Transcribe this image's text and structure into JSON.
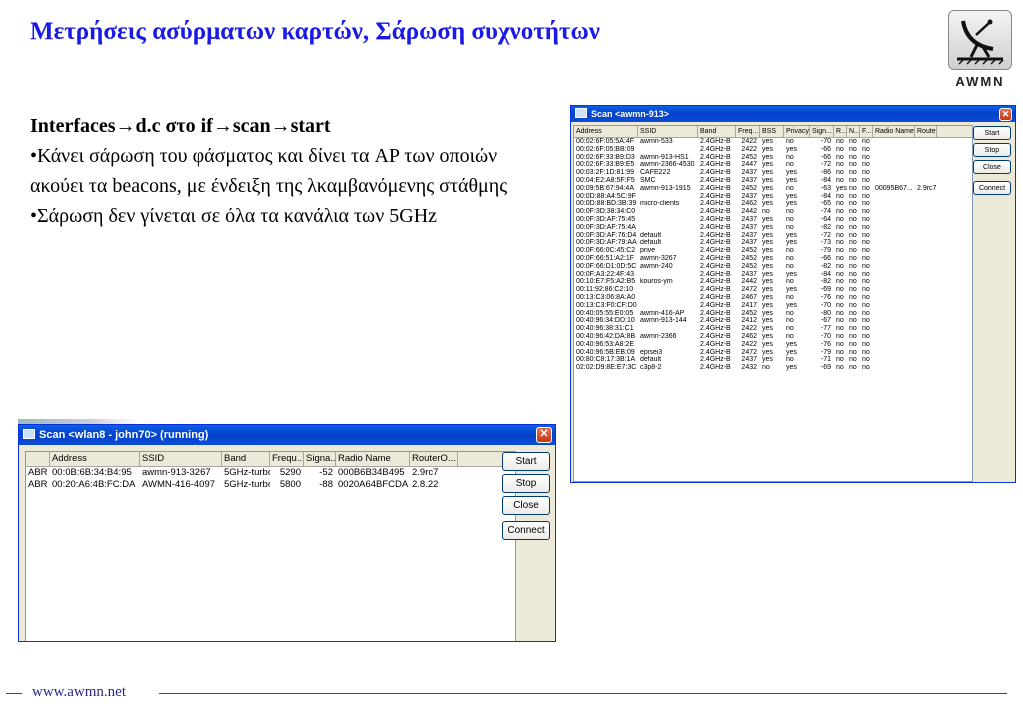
{
  "slide": {
    "title": "Μετρήσεις ασύρματων καρτών, Σάρωση συχνοτήτων",
    "logo_text": "AWMN",
    "heading": "Interfaces→d.c στο if→scan→start",
    "bullets": [
      "•Κάνει σάρωση του φάσματος και δίνει τα AP των οποιών ακούει τα beacons, με ένδειξη της λκαμβανόμενης στάθμης",
      "•Σάρωση δεν γίνεται σε όλα τα κανάλια των 5GHz"
    ],
    "footer_url": "www.awmn.net"
  },
  "scan_big": {
    "title": "Scan <awmn-913>",
    "close": "✕",
    "columns": [
      "Address",
      "SSID",
      "Band",
      "Freq...",
      "BSS",
      "Privacy",
      "Sign...",
      "R...",
      "N...",
      "F...",
      "Radio Name",
      "Router..."
    ],
    "rows": [
      [
        "00:02:6F:05:5A:4F",
        "awmn-533",
        "2.4GHz-B",
        "2422",
        "yes",
        "no",
        "-70",
        "no",
        "no",
        "no",
        "",
        ""
      ],
      [
        "00:02:6F:05:BB:09",
        "",
        "2.4GHz-B",
        "2422",
        "yes",
        "yes",
        "-66",
        "no",
        "no",
        "no",
        "",
        ""
      ],
      [
        "00:02:6F:33:B9:D3",
        "awmn-913-HS1",
        "2.4GHz-B",
        "2452",
        "yes",
        "no",
        "-66",
        "no",
        "no",
        "no",
        "",
        ""
      ],
      [
        "00:02:6F:33:B9:E5",
        "awmn-2366-4530",
        "2.4GHz-B",
        "2447",
        "yes",
        "no",
        "-72",
        "no",
        "no",
        "no",
        "",
        ""
      ],
      [
        "00:03:2F:1D:81:99",
        "CAFE222",
        "2.4GHz-B",
        "2437",
        "yes",
        "yes",
        "-86",
        "no",
        "no",
        "no",
        "",
        ""
      ],
      [
        "00:04:E2:A8:5F:F5",
        "SMC",
        "2.4GHz-B",
        "2437",
        "yes",
        "yes",
        "-84",
        "no",
        "no",
        "no",
        "",
        ""
      ],
      [
        "00:09:5B:67:94:4A",
        "awmn-913-1915",
        "2.4GHz-B",
        "2452",
        "yes",
        "no",
        "-63",
        "yes",
        "no",
        "no",
        "00095B67...",
        "2.9rc7"
      ],
      [
        "00:0D:88:A4:5C:9F",
        "",
        "2.4GHz-B",
        "2437",
        "yes",
        "yes",
        "-84",
        "no",
        "no",
        "no",
        "",
        ""
      ],
      [
        "00:0D:88:BD:3B:39",
        "micro-clients",
        "2.4GHz-B",
        "2462",
        "yes",
        "yes",
        "-65",
        "no",
        "no",
        "no",
        "",
        ""
      ],
      [
        "00:0F:3D:38:34:C0",
        "",
        "2.4GHz-B",
        "2442",
        "no",
        "no",
        "-74",
        "no",
        "no",
        "no",
        "",
        ""
      ],
      [
        "00:0F:3D:AF:75:45",
        "",
        "2.4GHz-B",
        "2437",
        "yes",
        "no",
        "-64",
        "no",
        "no",
        "no",
        "",
        ""
      ],
      [
        "00:0F:3D:AF:75:4A",
        "",
        "2.4GHz-B",
        "2437",
        "yes",
        "no",
        "-82",
        "no",
        "no",
        "no",
        "",
        ""
      ],
      [
        "00:0F:3D:AF:76:D4",
        "default",
        "2.4GHz-B",
        "2437",
        "yes",
        "yes",
        "-72",
        "no",
        "no",
        "no",
        "",
        ""
      ],
      [
        "00:0F:3D:AF:79:AA",
        "default",
        "2.4GHz-B",
        "2437",
        "yes",
        "yes",
        "-73",
        "no",
        "no",
        "no",
        "",
        ""
      ],
      [
        "00:0F:66:0C:45:C2",
        "prive",
        "2.4GHz-B",
        "2452",
        "yes",
        "no",
        "-79",
        "no",
        "no",
        "no",
        "",
        ""
      ],
      [
        "00:0F:66:51:A2:1F",
        "awmn-3267",
        "2.4GHz-B",
        "2452",
        "yes",
        "no",
        "-66",
        "no",
        "no",
        "no",
        "",
        ""
      ],
      [
        "00:0F:66:D1:0D:5C",
        "awmn-240",
        "2.4GHz-B",
        "2452",
        "yes",
        "no",
        "-82",
        "no",
        "no",
        "no",
        "",
        ""
      ],
      [
        "00:0F:A3:22:4F:43",
        "",
        "2.4GHz-B",
        "2437",
        "yes",
        "yes",
        "-84",
        "no",
        "no",
        "no",
        "",
        ""
      ],
      [
        "00:10:E7:F5:A2:B5",
        "kouros-ym",
        "2.4GHz-B",
        "2442",
        "yes",
        "no",
        "-82",
        "no",
        "no",
        "no",
        "",
        ""
      ],
      [
        "00:11:92:86:C2:10",
        "",
        "2.4GHz-B",
        "2472",
        "yes",
        "yes",
        "-69",
        "no",
        "no",
        "no",
        "",
        ""
      ],
      [
        "00:13:C3:06:8A:A0",
        "",
        "2.4GHz-B",
        "2467",
        "yes",
        "no",
        "-76",
        "no",
        "no",
        "no",
        "",
        ""
      ],
      [
        "00:13:C3:F0:CF:D0",
        "",
        "2.4GHz-B",
        "2417",
        "yes",
        "yes",
        "-70",
        "no",
        "no",
        "no",
        "",
        ""
      ],
      [
        "00:40:05:55:E0:05",
        "awmn-416-AP",
        "2.4GHz-B",
        "2452",
        "yes",
        "no",
        "-80",
        "no",
        "no",
        "no",
        "",
        ""
      ],
      [
        "00:40:96:34:DD:10",
        "awmn-913-144",
        "2.4GHz-B",
        "2412",
        "yes",
        "no",
        "-67",
        "no",
        "no",
        "no",
        "",
        ""
      ],
      [
        "00:40:96:38:31:C1",
        "",
        "2.4GHz-B",
        "2422",
        "yes",
        "no",
        "-77",
        "no",
        "no",
        "no",
        "",
        ""
      ],
      [
        "00:40:96:42:DA:8B",
        "awmn-2366",
        "2.4GHz-B",
        "2462",
        "yes",
        "no",
        "-70",
        "no",
        "no",
        "no",
        "",
        ""
      ],
      [
        "00:40:96:53:A8:2E",
        "",
        "2.4GHz-B",
        "2422",
        "yes",
        "yes",
        "-76",
        "no",
        "no",
        "no",
        "",
        ""
      ],
      [
        "00:40:96:5B:EB:09",
        "episei3",
        "2.4GHz-B",
        "2472",
        "yes",
        "yes",
        "-79",
        "no",
        "no",
        "no",
        "",
        ""
      ],
      [
        "00:80:C8:17:3B:1A",
        "default",
        "2.4GHz-B",
        "2437",
        "yes",
        "no",
        "-71",
        "no",
        "no",
        "no",
        "",
        ""
      ],
      [
        "02:02:D9:8E:E7:3C",
        "c3p8-2",
        "2.4GHz-B",
        "2432",
        "no",
        "yes",
        "-69",
        "no",
        "no",
        "no",
        "",
        ""
      ]
    ],
    "buttons": {
      "start": "Start",
      "stop": "Stop",
      "close": "Close",
      "connect": "Connect"
    }
  },
  "scan_small": {
    "title": "Scan <wlan8 - john70> (running)",
    "close": "✕",
    "columns": [
      "",
      "Address",
      "SSID",
      "Band",
      "Frequ...",
      "Signa...",
      "Radio Name",
      "RouterO..."
    ],
    "rows": [
      [
        "ABR",
        "00:0B:6B:34:B4:95",
        "awmn-913-3267",
        "5GHz-turbo",
        "5290",
        "-52",
        "000B6B34B495",
        "2.9rc7"
      ],
      [
        "ABR",
        "00:20:A6:4B:FC:DA",
        "AWMN-416-4097",
        "5GHz-turbo",
        "5800",
        "-88",
        "0020A64BFCDA",
        "2.8.22"
      ]
    ],
    "buttons": {
      "start": "Start",
      "stop": "Stop",
      "close": "Close",
      "connect": "Connect"
    }
  }
}
